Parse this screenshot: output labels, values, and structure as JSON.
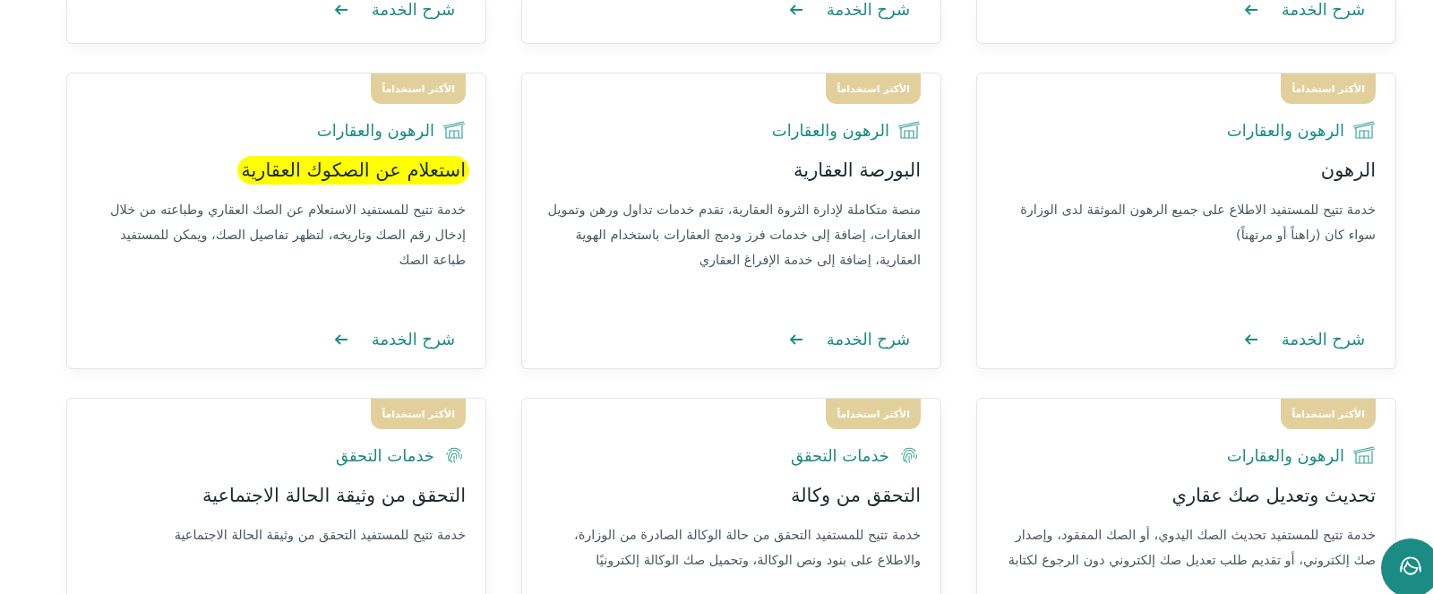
{
  "rows": [
    {
      "cards": [
        {
          "link": "شرح الخدمة"
        },
        {
          "link": "شرح الخدمة"
        },
        {
          "link": "شرح الخدمة"
        }
      ]
    },
    {
      "cards": [
        {
          "badge": "الأكثر استخداماً",
          "category": {
            "kind": "building",
            "label": "الرهون والعقارات"
          },
          "title": "الرهون",
          "title_highlighted": false,
          "description_lines": [
            "خدمة تتيح للمستفيد الاطلاع على جميع الرهون الموثقة لدى الوزارة",
            "سواء كان (راهناً أو مرتهناً)"
          ],
          "link": "شرح الخدمة"
        },
        {
          "badge": "الأكثر استخداماً",
          "category": {
            "kind": "building",
            "label": "الرهون والعقارات"
          },
          "title": "البورصة العقارية",
          "title_highlighted": false,
          "description_lines": [
            "منصة متكاملة لإدارة الثروة العقارية، تقدم خدمات تداول ورهن وتمويل",
            "العقارات، إضافة إلى خدمات فرز ودمج العقارات باستخدام الهوية",
            "العقارية، إضافة إلى خدمة الإفراغ العقاري"
          ],
          "link": "شرح الخدمة"
        },
        {
          "badge": "الأكثر استخداماً",
          "category": {
            "kind": "building",
            "label": "الرهون والعقارات"
          },
          "title": "استعلام عن الصكوك العقارية",
          "title_highlighted": true,
          "description_lines": [
            "خدمة تتيح للمستفيد الاستعلام عن الصك العقاري وطباعته من خلال",
            "إدخال رقم الصك وتاريخه، لتظهر تفاصيل الصك، ويمكن للمستفيد",
            "طباعة الصك"
          ],
          "link": "شرح الخدمة"
        }
      ]
    },
    {
      "cards": [
        {
          "badge": "الأكثر استخداماً",
          "category": {
            "kind": "building",
            "label": "الرهون والعقارات"
          },
          "title": "تحديث وتعديل صك عقاري",
          "title_highlighted": false,
          "description_lines": [
            "خدمة تتيح للمستفيد تحديث الصك اليدوي، أو الصك المفقود، وإصدار",
            "صك إلكتروني، أو تقديم طلب تعديل صك إلكتروني دون الرجوع لكتابة"
          ]
        },
        {
          "badge": "الأكثر استخداماً",
          "category": {
            "kind": "fingerprint",
            "label": "خدمات التحقق"
          },
          "title": "التحقق من وكالة",
          "title_highlighted": false,
          "description_lines": [
            "خدمة تتيح للمستفيد التحقق من حالة الوكالة الصادرة من الوزارة،",
            "والاطلاع على بنود ونص الوكالة، وتحميل صك الوكالة إلكترونيًا"
          ]
        },
        {
          "badge": "الأكثر استخداماً",
          "category": {
            "kind": "fingerprint",
            "label": "خدمات التحقق"
          },
          "title": "التحقق من وثيقة الحالة الاجتماعية",
          "title_highlighted": false,
          "description_lines": [
            "خدمة تتيح للمستفيد التحقق من وثيقة الحالة الاجتماعية"
          ]
        }
      ]
    }
  ],
  "chat_button": {
    "kind": "support"
  }
}
